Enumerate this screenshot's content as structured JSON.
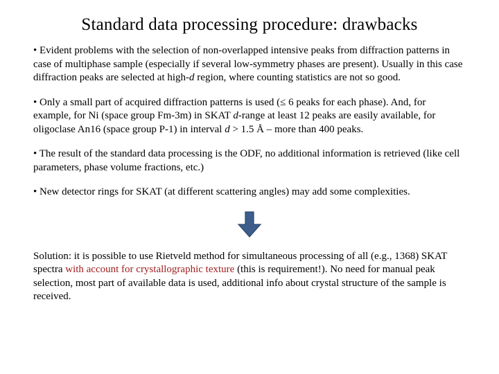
{
  "title": "Standard data processing procedure: drawbacks",
  "bullets": {
    "b1": "• Evident problems with the selection of non-overlapped intensive peaks from diffraction patterns in case of multiphase sample (especially if several low-symmetry phases are present). Usually in this case diffraction peaks are selected at high-",
    "b1_i1": "d",
    "b1_r1": " region, where counting statistics are not so good.",
    "b2": "• Only a small part of acquired diffraction patterns is used (≤ 6 peaks for each phase). And, for example, for Ni (space group Fm-3m) in SKAT ",
    "b2_i1": "d",
    "b2_r1": "-range at least 12 peaks are easily available, for oligoclase An16 (space group P-1) in interval ",
    "b2_i2": "d",
    "b2_r2": " > 1.5 Å – more than 400 peaks.",
    "b3": "• The result of the standard data processing is the ODF, no additional information is retrieved (like cell parameters, phase volume fractions, etc.)",
    "b4": "• New detector rings for SKAT (at different scattering angles) may add some complexities.",
    "sol_a": "Solution: it is possible to use Rietveld method for simultaneous processing of all (e.g., 1368) SKAT spectra ",
    "sol_red": "with account for crystallographic texture",
    "sol_b": " (this is requirement!). No need for manual peak selection, most part of available data is used, additional info about crystal structure of the sample is received."
  },
  "icons": {
    "arrow": "down-arrow-icon"
  },
  "colors": {
    "accent_red": "#a02020",
    "arrow_fill": "#3d5e8a",
    "arrow_stroke": "#29486e"
  }
}
